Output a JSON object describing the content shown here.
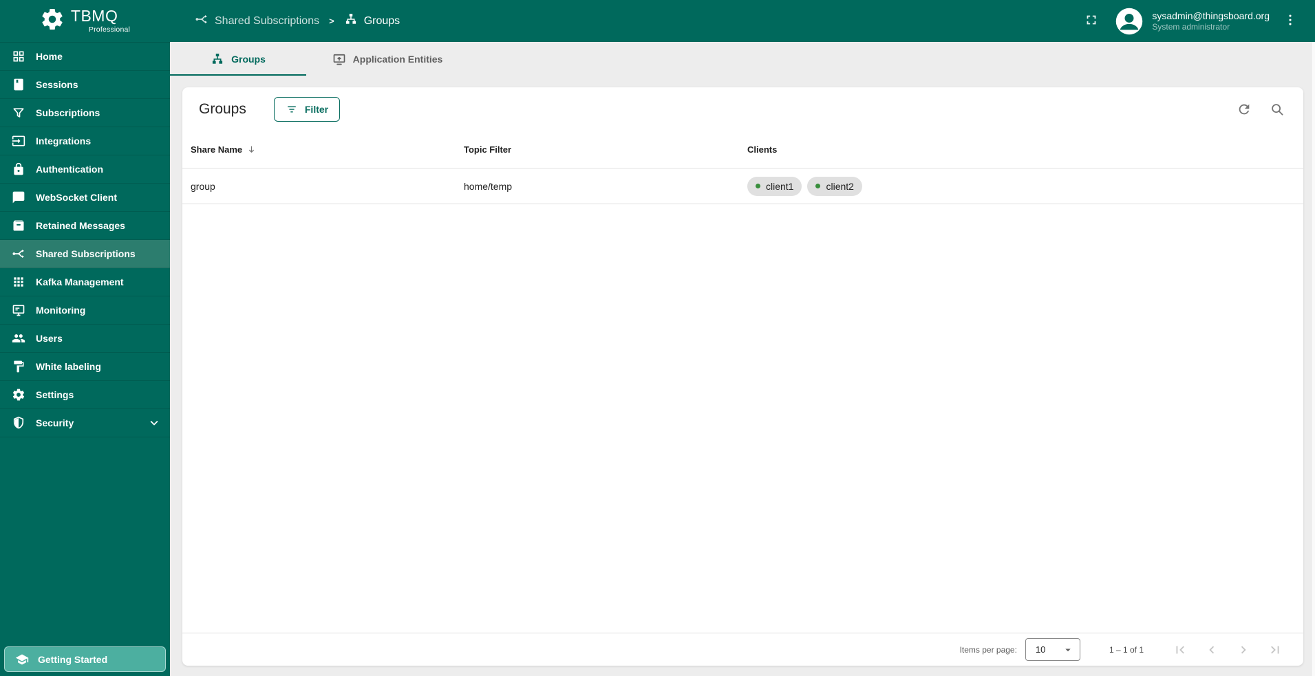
{
  "app": {
    "logo_title": "TBMQ",
    "logo_subtitle": "Professional"
  },
  "header": {
    "breadcrumb_separator": ">",
    "breadcrumb": [
      {
        "label": "Shared Subscriptions",
        "icon": "mediation-icon"
      },
      {
        "label": "Groups",
        "icon": "lan-icon"
      }
    ],
    "user": {
      "email": "sysadmin@thingsboard.org",
      "role": "System administrator"
    }
  },
  "sidebar": {
    "items": [
      {
        "label": "Home",
        "icon": "dashboard-icon",
        "active": false
      },
      {
        "label": "Sessions",
        "icon": "book-icon",
        "active": false
      },
      {
        "label": "Subscriptions",
        "icon": "filter-funnel-icon",
        "active": false
      },
      {
        "label": "Integrations",
        "icon": "input-icon",
        "active": false
      },
      {
        "label": "Authentication",
        "icon": "lock-icon",
        "active": false
      },
      {
        "label": "WebSocket Client",
        "icon": "chat-icon",
        "active": false
      },
      {
        "label": "Retained Messages",
        "icon": "archive-icon",
        "active": false
      },
      {
        "label": "Shared Subscriptions",
        "icon": "mediation-icon",
        "active": true
      },
      {
        "label": "Kafka Management",
        "icon": "apps-grid-icon",
        "active": false
      },
      {
        "label": "Monitoring",
        "icon": "monitor-icon",
        "active": false
      },
      {
        "label": "Users",
        "icon": "people-icon",
        "active": false
      },
      {
        "label": "White labeling",
        "icon": "paint-roller-icon",
        "active": false
      },
      {
        "label": "Settings",
        "icon": "gear-icon",
        "active": false
      },
      {
        "label": "Security",
        "icon": "shield-icon",
        "active": false,
        "expandable": true
      }
    ],
    "getting_started_label": "Getting Started"
  },
  "tabs": [
    {
      "label": "Groups",
      "icon": "lan-icon",
      "active": true
    },
    {
      "label": "Application Entities",
      "icon": "application-monitor-icon",
      "active": false
    }
  ],
  "main": {
    "title": "Groups",
    "filter_button_label": "Filter",
    "table": {
      "columns": [
        "Share Name",
        "Topic Filter",
        "Clients"
      ],
      "rows": [
        {
          "share_name": "group",
          "topic_filter": "home/temp",
          "clients": [
            "client1",
            "client2"
          ]
        }
      ]
    },
    "pagination": {
      "items_per_page_label": "Items per page:",
      "page_size": "10",
      "range_label": "1 – 1 of 1"
    }
  },
  "colors": {
    "primary": "#00695c",
    "sidebar_active": "#2c7d6e",
    "getting_started_bg": "#4cafa0",
    "chip_bg": "#e0e0e0",
    "client_status_dot": "#388e3c",
    "content_bg": "#ededed"
  }
}
